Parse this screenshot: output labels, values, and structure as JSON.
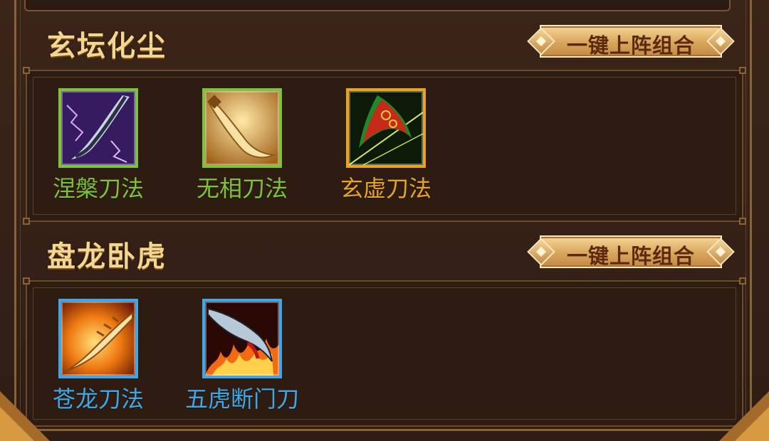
{
  "sections": [
    {
      "title": "玄坛化尘",
      "button_label": "一键上阵组合",
      "skills": [
        {
          "name": "涅槃刀法",
          "rarity_color": "#7cc23b",
          "icon": "lightning-blade-icon"
        },
        {
          "name": "无相刀法",
          "rarity_color": "#7cc23b",
          "icon": "golden-blade-icon"
        },
        {
          "name": "玄虚刀法",
          "rarity_color": "#e5a423",
          "icon": "ornate-red-blade-icon"
        }
      ]
    },
    {
      "title": "盘龙卧虎",
      "button_label": "一键上阵组合",
      "skills": [
        {
          "name": "苍龙刀法",
          "rarity_color": "#3fa7e8",
          "icon": "fire-dragon-blade-icon"
        },
        {
          "name": "五虎断门刀",
          "rarity_color": "#3fa7e8",
          "icon": "flame-blade-icon"
        }
      ]
    }
  ]
}
